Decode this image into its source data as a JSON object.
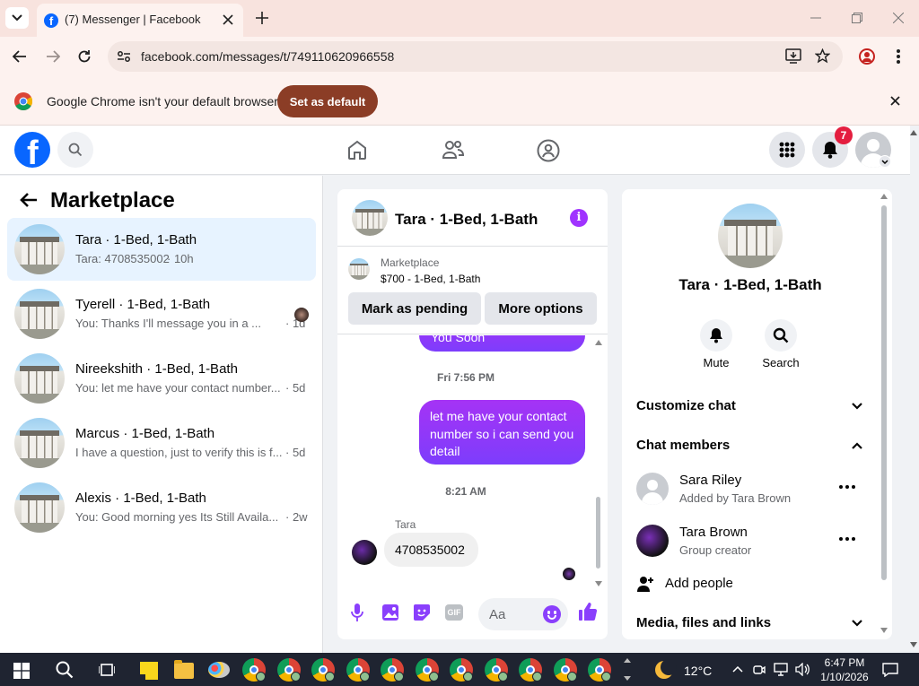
{
  "browser": {
    "tab_title": "(7) Messenger | Facebook",
    "url": "facebook.com/messages/t/749110620966558",
    "infobar_text": "Google Chrome isn't your default browser",
    "set_default_label": "Set as default"
  },
  "fb_nav": {
    "notification_count": "7"
  },
  "left_panel": {
    "title": "Marketplace",
    "conversations": [
      {
        "name": "Tara · 1-Bed, 1-Bath",
        "preview": "Tara: 4708535002",
        "time": "· 10h"
      },
      {
        "name": "Tyerell · 1-Bed, 1-Bath",
        "preview": "You: Thanks I'll message you in a ...",
        "time": "· 1d"
      },
      {
        "name": "Nireekshith · 1-Bed, 1-Bath",
        "preview": "You: let me have your contact number...",
        "time": "· 5d"
      },
      {
        "name": "Marcus · 1-Bed, 1-Bath",
        "preview": "I have a question, just to verify this is f...",
        "time": "· 5d"
      },
      {
        "name": "Alexis · 1-Bed, 1-Bath",
        "preview": "You: Good morning yes Its Still Availa...",
        "time": "· 2w"
      }
    ]
  },
  "chat": {
    "header_title": "Tara · 1-Bed, 1-Bath",
    "listing_label": "Marketplace",
    "listing_detail": "$700 - 1-Bed, 1-Bath",
    "mark_pending": "Mark as pending",
    "more_options": "More options",
    "partial_bubble": "You Soon",
    "timestamp1": "Fri 7:56 PM",
    "sent_message": "let me have your contact number so i can send you detail",
    "timestamp2": "8:21 AM",
    "sender_name": "Tara",
    "received_message": "4708535002",
    "composer_placeholder": "Aa",
    "gif_label": "GIF"
  },
  "right_panel": {
    "title": "Tara · 1-Bed, 1-Bath",
    "mute_label": "Mute",
    "search_label": "Search",
    "customize_chat": "Customize chat",
    "chat_members": "Chat members",
    "members": [
      {
        "name": "Sara Riley",
        "role": "Added by Tara Brown"
      },
      {
        "name": "Tara Brown",
        "role": "Group creator"
      }
    ],
    "add_people": "Add people",
    "media_files": "Media, files and links"
  },
  "taskbar": {
    "weather": "12°C",
    "time": "6:47 PM",
    "date": "1/10/2026"
  },
  "colors": {
    "fb_blue": "#0866ff",
    "messenger_purple": "#8a3ffc",
    "badge_red": "#e41e3f"
  }
}
